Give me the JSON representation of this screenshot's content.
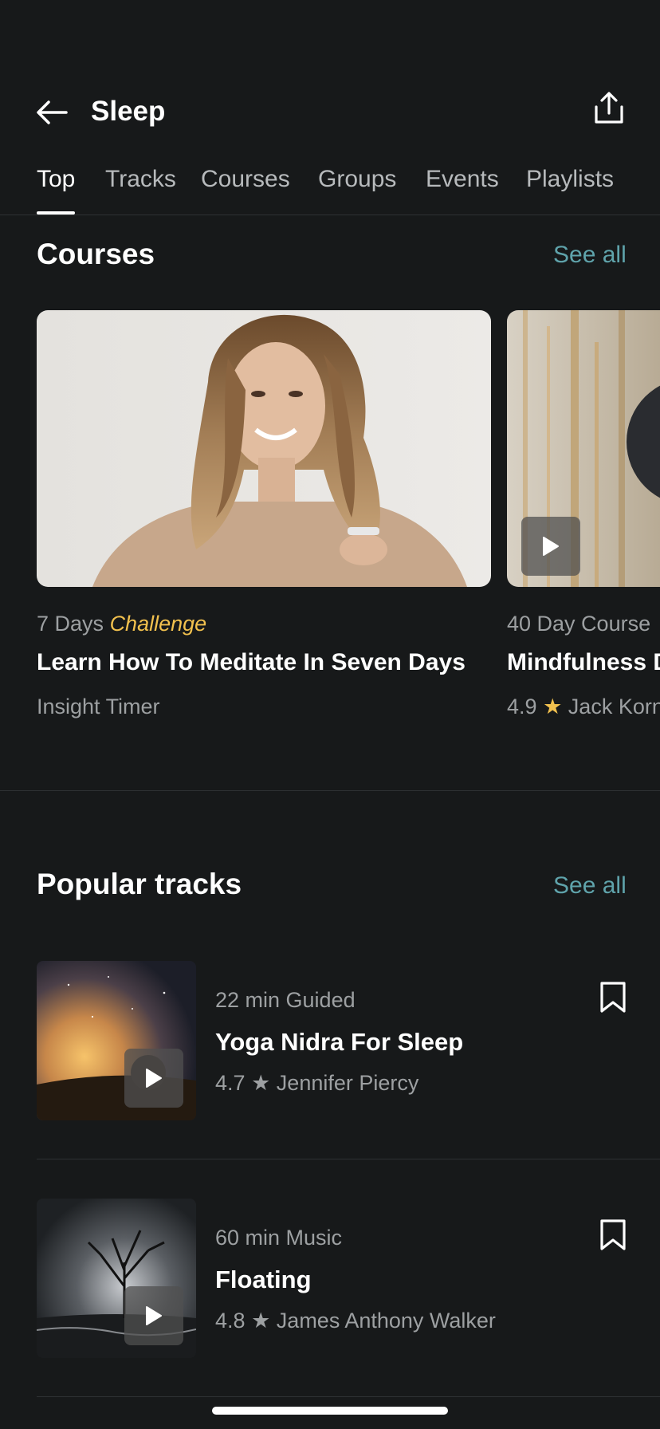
{
  "header": {
    "title": "Sleep"
  },
  "tabs": [
    {
      "label": "Top",
      "active": true
    },
    {
      "label": "Tracks",
      "active": false
    },
    {
      "label": "Courses",
      "active": false
    },
    {
      "label": "Groups",
      "active": false
    },
    {
      "label": "Events",
      "active": false
    },
    {
      "label": "Playlists",
      "active": false
    }
  ],
  "courses_section": {
    "title": "Courses",
    "see_all": "See all",
    "items": [
      {
        "meta_prefix": "7 Days",
        "meta_highlight": "Challenge",
        "title": "Learn How To Meditate In Seven Days",
        "author": "Insight Timer"
      },
      {
        "meta_prefix": "40 Day Course",
        "title": "Mindfulness D",
        "rating": "4.9",
        "author": "Jack Korn"
      }
    ]
  },
  "tracks_section": {
    "title": "Popular tracks",
    "see_all": "See all",
    "items": [
      {
        "meta": "22 min Guided",
        "title": "Yoga Nidra For Sleep",
        "rating": "4.7",
        "author": "Jennifer Piercy"
      },
      {
        "meta": "60 min Music",
        "title": "Floating",
        "rating": "4.8",
        "author": "James Anthony Walker"
      }
    ]
  },
  "colors": {
    "background": "#17191a",
    "accent_teal": "#5fa3ab",
    "accent_gold": "#f2c14e"
  }
}
